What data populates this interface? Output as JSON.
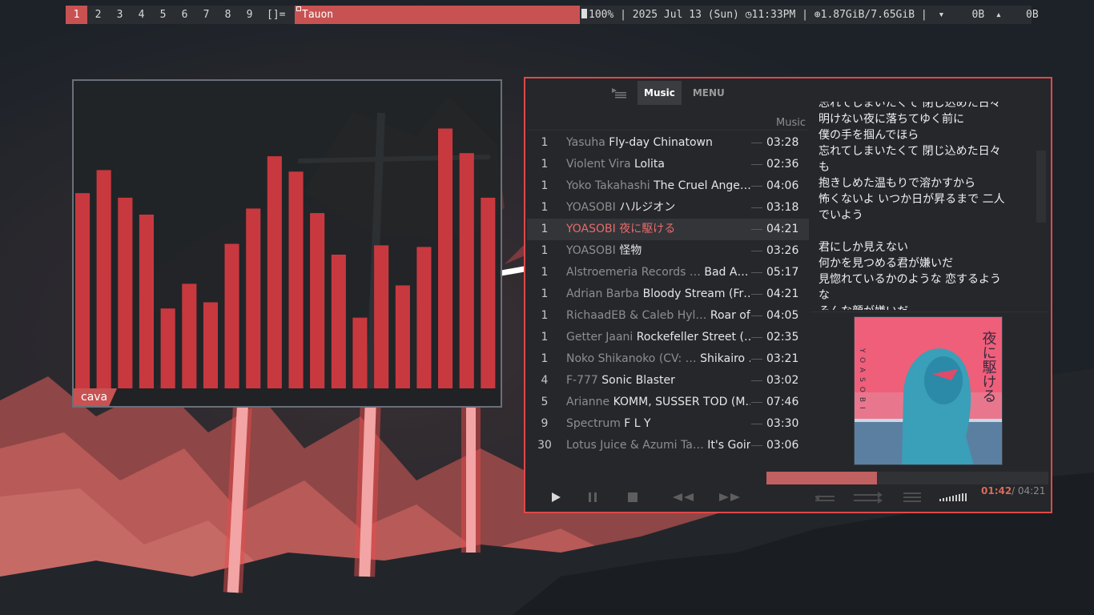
{
  "topbar": {
    "workspaces": [
      "1",
      "2",
      "3",
      "4",
      "5",
      "6",
      "7",
      "8",
      "9"
    ],
    "active_workspace": "1",
    "layout": "[]=",
    "window_title": "Tauon",
    "battery": "100%",
    "date": "2025 Jul 13 (Sun)",
    "time": "11:33PM",
    "memory": "1.87GiB/7.65GiB",
    "net_down": "0B",
    "net_up": "0B",
    "sep": "|"
  },
  "cava": {
    "label": "cava",
    "bar_levels": [
      0.635,
      0.71,
      0.62,
      0.565,
      0.26,
      0.34,
      0.28,
      0.47,
      0.585,
      0.755,
      0.705,
      0.57,
      0.435,
      0.23,
      0.465,
      0.335,
      0.46,
      0.845,
      0.765,
      0.62
    ],
    "bar_color": "#c8393f"
  },
  "tauon": {
    "tabs": {
      "music": "Music",
      "menu": "MENU"
    },
    "playlist_header": "Music",
    "tracks": [
      {
        "num": "1",
        "artist": "Yasuha",
        "title": "Fly-day Chinatown",
        "duration": "03:28"
      },
      {
        "num": "1",
        "artist": "Violent Vira",
        "title": "Lolita",
        "duration": "02:36"
      },
      {
        "num": "1",
        "artist": "Yoko Takahashi",
        "title": "The Cruel Ange…",
        "duration": "04:06"
      },
      {
        "num": "1",
        "artist": "YOASOBI",
        "title": "ハルジオン",
        "duration": "03:18"
      },
      {
        "num": "1",
        "artist": "YOASOBI",
        "title": "夜に駆ける",
        "duration": "04:21",
        "current": true
      },
      {
        "num": "1",
        "artist": "YOASOBI",
        "title": "怪物",
        "duration": "03:26"
      },
      {
        "num": "1",
        "artist": "Alstroemeria Records …",
        "title": "Bad A…",
        "duration": "05:17"
      },
      {
        "num": "1",
        "artist": "Adrian Barba",
        "title": "Bloody Stream (Fr…",
        "duration": "04:21"
      },
      {
        "num": "1",
        "artist": "RichaadEB & Caleb Hyl…",
        "title": "Roar of t…",
        "duration": "04:05"
      },
      {
        "num": "1",
        "artist": "Getter Jaani",
        "title": "Rockefeller Street (…",
        "duration": "02:35"
      },
      {
        "num": "1",
        "artist": "Noko Shikanoko (CV: …",
        "title": "Shikairo …",
        "duration": "03:21"
      },
      {
        "num": "4",
        "artist": "F-777",
        "title": "Sonic Blaster",
        "duration": "03:02"
      },
      {
        "num": "5",
        "artist": "Arianne",
        "title": "KOMM, SUSSER TOD (M…",
        "duration": "07:46"
      },
      {
        "num": "9",
        "artist": "Spectrum",
        "title": "F L Y",
        "duration": "03:30"
      },
      {
        "num": "30",
        "artist": "Lotus Juice & Azumi Ta…",
        "title": "It's Goin…",
        "duration": "03:06"
      }
    ],
    "lyrics": [
      "忘れてしまいたくて 閉じ込めた日々",
      "明けない夜に落ちてゆく前に",
      "僕の手を掴んでほら",
      "忘れてしまいたくて 閉じ込めた日々",
      "も",
      "抱きしめた温もりで溶かすから",
      "怖くないよ いつか日が昇るまで 二人",
      "でいよう",
      "",
      "君にしか見えない",
      "何かを見つめる君が嫌いだ",
      "見惚れているかのような 恋するよう",
      "な",
      "そんな顔が嫌いだ"
    ],
    "album_art": {
      "artist_vertical": "YOASOBI",
      "title_vertical": "夜に駆ける"
    },
    "progress_fraction": 0.391,
    "time_current": "01:42",
    "time_total": "/ 04:21",
    "accent": "#e04848"
  }
}
